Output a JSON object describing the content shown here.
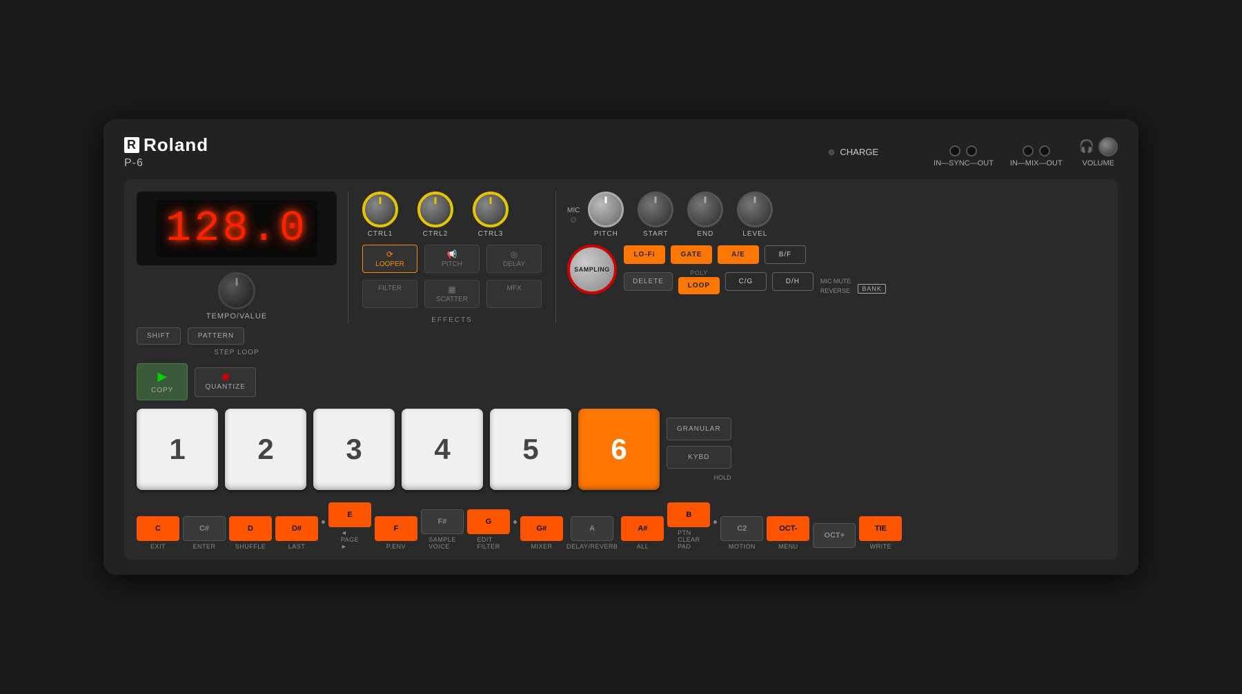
{
  "device": {
    "brand": "Roland",
    "model": "P-6",
    "display_value": "128.0",
    "charge_label": "CHARGE",
    "in_sync_out_label": "IN—SYNC—OUT",
    "in_mix_out_label": "IN—MIX—OUT",
    "volume_label": "VOLUME",
    "tempo_label": "TEMPO/VALUE",
    "ctrl1_label": "CTRL1",
    "ctrl2_label": "CTRL2",
    "ctrl3_label": "CTRL3",
    "pitch_label": "PITCH",
    "start_label": "START",
    "end_label": "END",
    "level_label": "LEVEL",
    "looper_label": "LOOPER",
    "pitch_fx_label": "PITCH",
    "delay_label": "DELAY",
    "filter_label": "FILTER",
    "scatter_label": "SCATTER",
    "mfx_label": "MFX",
    "effects_label": "EFFECTS",
    "mic_label": "MIC",
    "sampling_label": "SAMPLING",
    "lofi_label": "LO-Fi",
    "gate_label": "GATE",
    "ae_label": "A/E",
    "bf_label": "B/F",
    "poly_label": "POLY",
    "delete_label": "DELETE",
    "loop_label": "LOOP",
    "cg_label": "C/G",
    "dh_label": "D/H",
    "mic_mute_label": "MIC MUTE",
    "reverse_label": "REVERSE",
    "bank_label": "BANK",
    "shift_label": "SHIFT",
    "pattern_label": "PATTERN",
    "step_loop_label": "STEP LOOP",
    "copy_label": "COPY",
    "quantize_label": "QUANTIZE",
    "granular_label": "GRANULAR",
    "kybd_label": "KYBD",
    "hold_label": "HOLD",
    "pad1": "1",
    "pad2": "2",
    "pad3": "3",
    "pad4": "4",
    "pad5": "5",
    "pad6": "6",
    "keys": [
      {
        "cap": "C",
        "label": "EXIT",
        "type": "orange"
      },
      {
        "cap": "C#",
        "label": "ENTER",
        "type": "gray"
      },
      {
        "cap": "D",
        "label": "SHUFFLE",
        "type": "orange"
      },
      {
        "cap": "D#",
        "label": "LAST",
        "type": "orange"
      },
      {
        "cap": "E",
        "label": "◄ PAGE ►",
        "type": "orange"
      },
      {
        "cap": "F",
        "label": "P.ENV",
        "type": "orange"
      },
      {
        "cap": "F#",
        "label": "SAMPLE VOICE",
        "type": "gray"
      },
      {
        "cap": "G",
        "label": "EDIT FILTER",
        "type": "orange"
      },
      {
        "cap": "G#",
        "label": "MIXER",
        "type": "orange"
      },
      {
        "cap": "A",
        "label": "DELAY/REVERB",
        "type": "gray"
      },
      {
        "cap": "A#",
        "label": "ALL",
        "type": "orange"
      },
      {
        "cap": "B",
        "label": "PTN CLEAR PAD",
        "type": "orange"
      },
      {
        "cap": "C2",
        "label": "MOTION",
        "type": "gray"
      },
      {
        "cap": "OCT-",
        "label": "MENU",
        "type": "orange"
      },
      {
        "cap": "OCT+",
        "label": "",
        "type": "gray"
      },
      {
        "cap": "TIE",
        "label": "WRITE",
        "type": "orange"
      }
    ]
  }
}
